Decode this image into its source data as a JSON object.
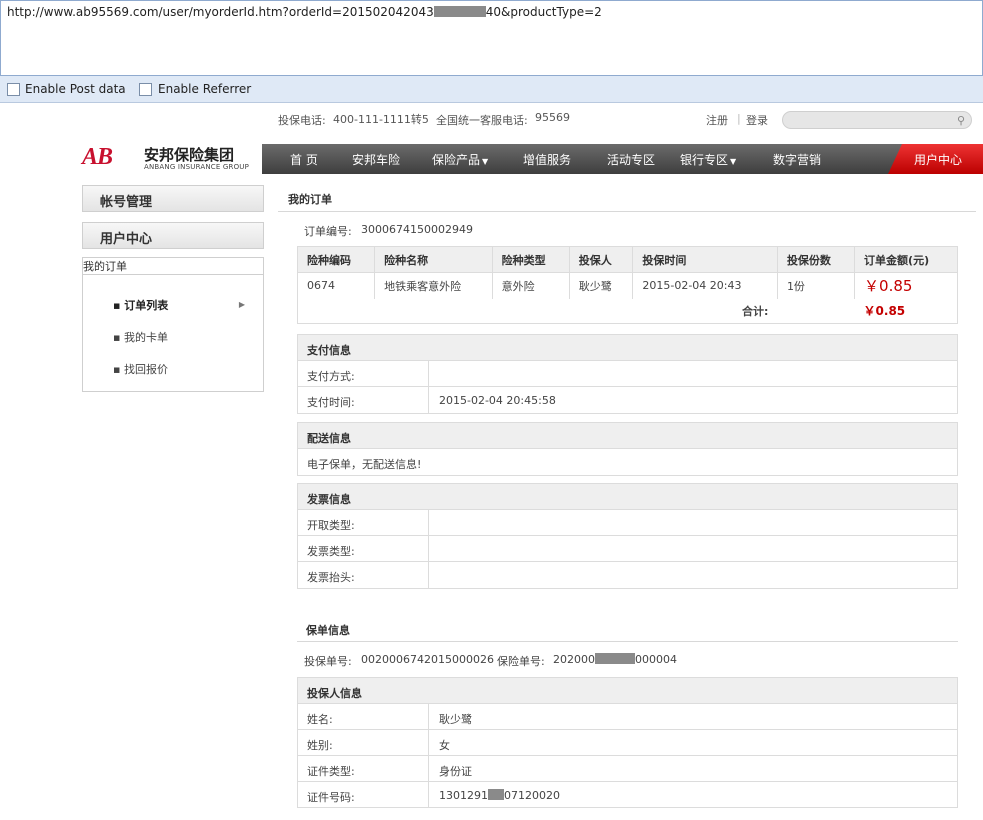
{
  "browser": {
    "url_prefix": "http://www.ab95569.com/user/myorderId.htm?orderId=201502042043",
    "url_suffix": "40&productType=2",
    "enable_post": "Enable Post data",
    "enable_referrer": "Enable Referrer"
  },
  "topbar": {
    "phone_label": "投保电话:",
    "phone": "400-111-1111转5",
    "service_label": "全国统一客服电话:",
    "service": "95569",
    "register": "注册",
    "login": "登录"
  },
  "logo": {
    "mark": "AB",
    "cn": "安邦保险集团",
    "en": "ANBANG INSURANCE GROUP"
  },
  "nav": {
    "items": [
      "首 页",
      "安邦车险",
      "保险产品",
      "增值服务",
      "活动专区",
      "银行专区",
      "数字营销"
    ],
    "user_center": "用户中心"
  },
  "sidebar": {
    "account": "帐号管理",
    "user_center": "用户中心",
    "my_orders": "我的订单",
    "sub": [
      "订单列表",
      "我的卡单",
      "找回报价"
    ]
  },
  "main": {
    "title": "我的订单",
    "order_no_label": "订单编号:",
    "order_no": "3000674150002949",
    "table": {
      "headers": [
        "险种编码",
        "险种名称",
        "险种类型",
        "投保人",
        "投保时间",
        "投保份数",
        "订单金额(元)"
      ],
      "row": [
        "0674",
        "地铁乘客意外险",
        "意外险",
        "耿少鹭",
        "2015-02-04 20:43",
        "1份",
        "￥0.85"
      ],
      "total_label": "合计:",
      "total": "￥0.85"
    },
    "payment": {
      "title": "支付信息",
      "method_label": "支付方式:",
      "method": "",
      "time_label": "支付时间:",
      "time": "2015-02-04 20:45:58"
    },
    "delivery": {
      "title": "配送信息",
      "text": "电子保单，无配送信息!"
    },
    "invoice": {
      "title": "发票信息",
      "rows": [
        "开取类型:",
        "发票类型:",
        "发票抬头:"
      ]
    },
    "policy": {
      "title": "保单信息",
      "app_no_label": "投保单号:",
      "app_no": "0020006742015000026",
      "policy_no_label": "保险单号:",
      "policy_no_prefix": "202000",
      "policy_no_suffix": "000004"
    },
    "holder": {
      "title": "投保人信息",
      "rows": [
        {
          "k": "姓名:",
          "v": "耿少鹭"
        },
        {
          "k": "姓别:",
          "v": "女"
        },
        {
          "k": "证件类型:",
          "v": "身份证"
        },
        {
          "k": "证件号码:",
          "v_prefix": "1301291",
          "v_suffix": "07120020"
        }
      ]
    }
  }
}
